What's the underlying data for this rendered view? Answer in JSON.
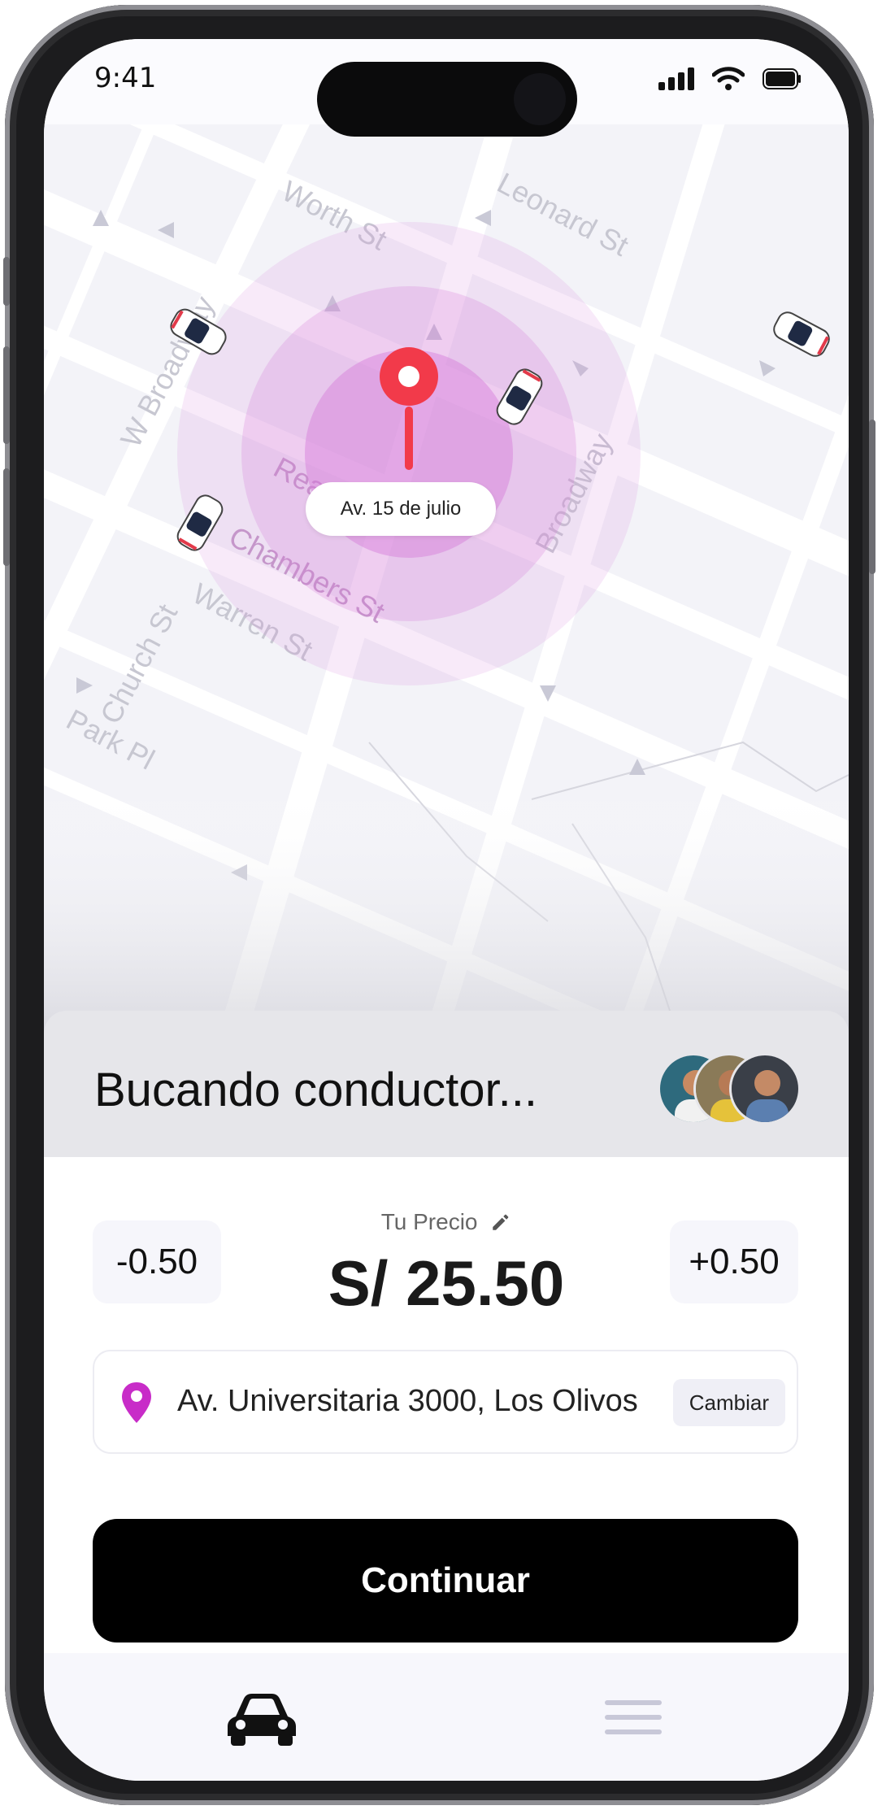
{
  "status": {
    "time": "9:41"
  },
  "map": {
    "streets": [
      "Worth St",
      "Leonard St",
      "W Broadway",
      "Broadway",
      "Reade St",
      "Chambers St",
      "Warren St",
      "Church St",
      "Park Pl"
    ],
    "pin_label": "Av. 15 de julio"
  },
  "sheet": {
    "title": "Bucando conductor...",
    "price": {
      "label": "Tu Precio",
      "value": "S/ 25.50",
      "decrease": "-0.50",
      "increase": "+0.50"
    },
    "destination": {
      "address": "Av. Universitaria 3000, Los Olivos",
      "change_label": "Cambiar"
    },
    "continue_label": "Continuar"
  },
  "colors": {
    "accent": "#c82cc8",
    "pin": "#f23a4a",
    "radar": "#d47ad9",
    "cta": "#000000"
  },
  "tabbar": {
    "items": [
      "car-icon",
      "menu-icon"
    ]
  }
}
